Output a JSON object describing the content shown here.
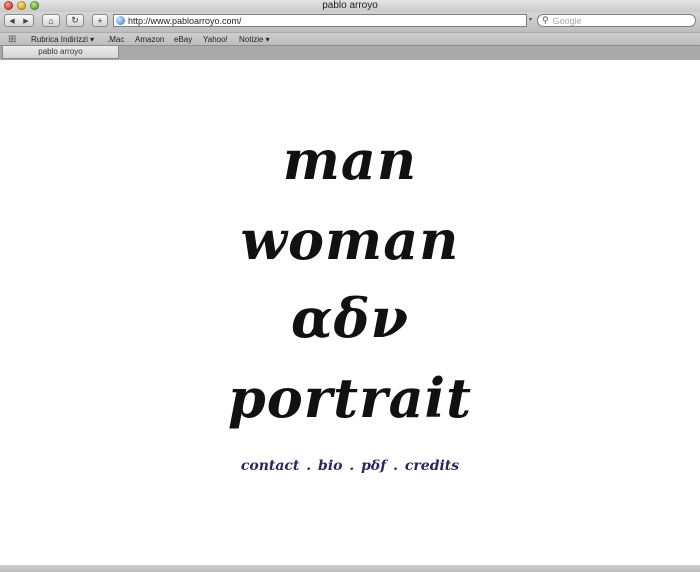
{
  "window": {
    "title": "pablo arroyo"
  },
  "toolbar": {
    "back_glyph": "◀",
    "forward_glyph": "▶",
    "home_glyph": "⌂",
    "reload_glyph": "↻",
    "add_glyph": "+",
    "url": "http://www.pabloarroyo.com/",
    "search_placeholder": "Google"
  },
  "bookmarks": [
    {
      "label": "Rubrica Indirizzi ▾"
    },
    {
      "label": ".Mac"
    },
    {
      "label": "Amazon"
    },
    {
      "label": "eBay"
    },
    {
      "label": "Yahoo!"
    },
    {
      "label": "Notizie ▾"
    }
  ],
  "tab": {
    "label": "pablo arroyo"
  },
  "page": {
    "words": [
      "man",
      "woman",
      "αδν",
      "portrait"
    ],
    "links": [
      "contact",
      "bio",
      "pδf",
      "credits"
    ],
    "separator": "."
  },
  "icons": {
    "search": "magnifier-icon",
    "globe": "globe-icon",
    "bookmarks": "book-icon"
  }
}
